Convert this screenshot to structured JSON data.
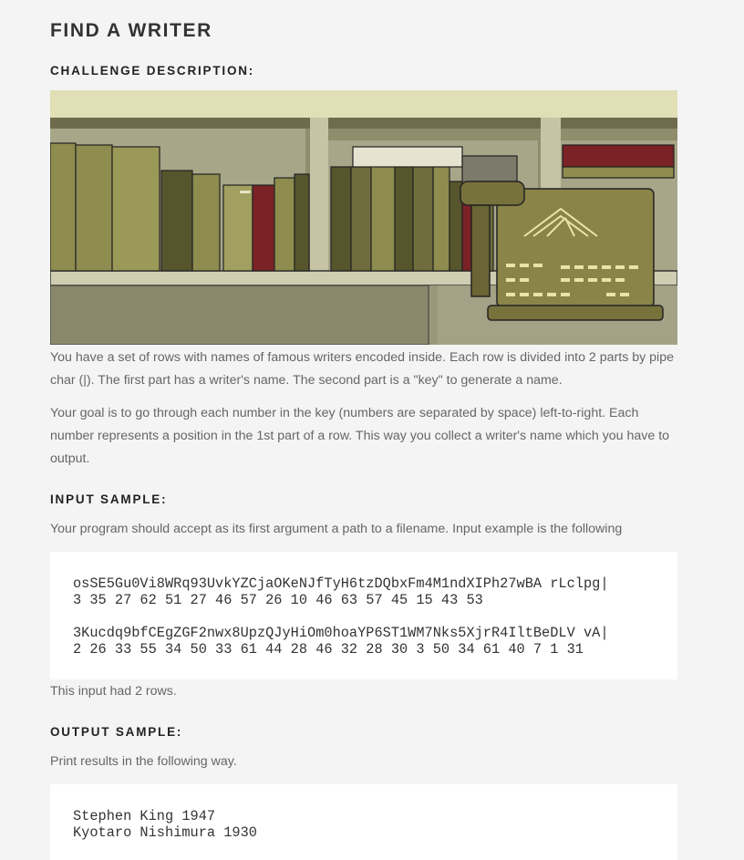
{
  "title": "FIND A WRITER",
  "sections": {
    "challenge": "CHALLENGE DESCRIPTION:",
    "input": "INPUT SAMPLE:",
    "output": "OUTPUT SAMPLE:"
  },
  "description": {
    "p1": "You have a set of rows with names of famous writers encoded inside. Each row is divided into 2 parts by pipe char (|). The first part has a writer's name. The second part is a \"key\" to generate a name.",
    "p2": "Your goal is to go through each number in the key (numbers are separated by space) left-to-right. Each number represents a position in the 1st part of a row. This way you collect a writer's name which you have to output."
  },
  "input_sample": {
    "intro": "Your program should accept as its first argument a path to a filename. Input example is the following",
    "rows": [
      {
        "encoded": "osSE5Gu0Vi8WRq93UvkYZCjaOKeNJfTyH6tzDQbxFm4M1ndXIPh27wBA rLclpg|",
        "key": "3 35 27 62 51 27 46 57 26 10 46 63 57 45 15 43 53"
      },
      {
        "encoded": "3Kucdq9bfCEgZGF2nwx8UpzQJyHiOm0hoaYP6ST1WM7Nks5XjrR4IltBeDLV vA|",
        "key": "2 26 33 55 34 50 33 61 44 28 46 32 28 30 3 50 34 61 40 7 1 31"
      }
    ],
    "note": "This input had 2 rows."
  },
  "output_sample": {
    "intro": "Print results in the following way.",
    "lines": [
      "Stephen King 1947",
      "Kyotaro Nishimura 1930"
    ]
  },
  "illustration": {
    "subject": "bookshelf-with-typewriter",
    "colors": {
      "wall": "#e1dfb5",
      "shelf": "#8f8d6c",
      "book_olive": "#8e8c4e",
      "book_dark": "#57552c",
      "book_red": "#7a2226",
      "typewriter": "#8a8448"
    }
  }
}
